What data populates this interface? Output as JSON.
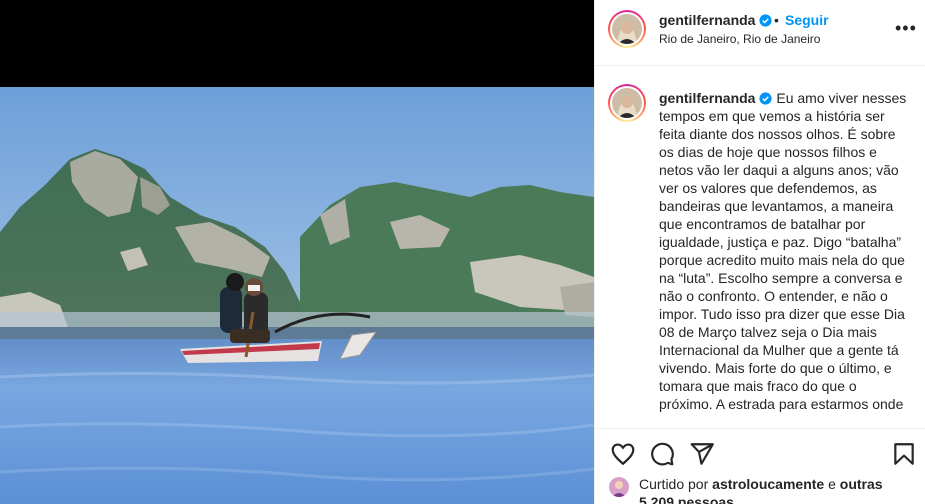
{
  "post": {
    "username": "gentilfernanda",
    "follow_label": "Seguir",
    "separator": "•",
    "location": "Rio de Janeiro, Rio de Janeiro",
    "more_label": "•••",
    "caption": "Eu amo viver nesses tempos em que vemos a história ser feita diante dos nossos olhos. É sobre os dias de hoje que nossos filhos e netos vão ler daqui a alguns anos; vão ver os valores que defendemos, as bandeiras que levantamos, a maneira que encontramos de batalhar por igualdade, justiça e paz. Digo “batalha” porque acredito muito mais nela do que na “luta”. Escolho sempre a conversa e não o confronto. O entender, e não o impor. Tudo isso pra dizer que esse Dia 08 de Março talvez seja o Dia mais Internacional da Mulher que a gente tá vivendo. Mais forte do que o último, e tomara que mais fraco do que o próximo. A estrada para estarmos onde"
  },
  "likes": {
    "prefix": "Curtido por",
    "liker": "astroloucamente",
    "connector": "e",
    "others": "outras 5.209 pessoas"
  },
  "icons": {
    "like": "heart-icon",
    "comment": "comment-icon",
    "share": "share-icon",
    "save": "bookmark-icon",
    "verified": "verified-badge-icon"
  },
  "colors": {
    "accent": "#0095f6",
    "text": "#262626",
    "border": "#efefef",
    "media_background": "#000000"
  }
}
